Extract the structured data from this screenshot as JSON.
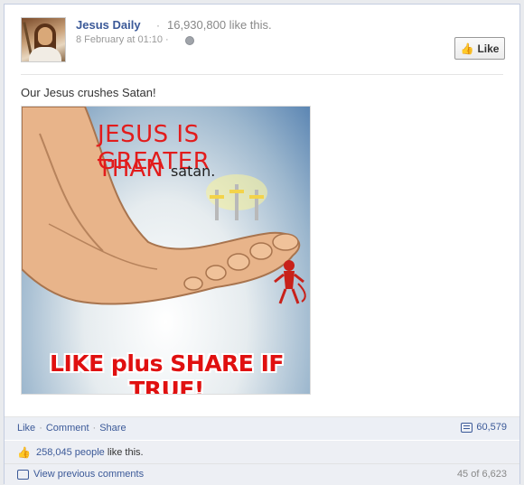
{
  "post": {
    "page_name": "Jesus Daily",
    "separator": "·",
    "page_likes": "16,930,800 like this.",
    "timestamp": "8 February at 01:10 ·",
    "like_button_label": "Like",
    "status_text": "Our Jesus crushes Satan!",
    "image": {
      "headline_line1": "JESUS IS GREATER",
      "headline_line2_big": "THAN",
      "headline_line2_small": "satan.",
      "call_to_action": "LIKE plus SHARE IF TRUE!"
    }
  },
  "actions": {
    "like": "Like",
    "comment": "Comment",
    "share": "Share",
    "dot": "·",
    "comments_count": "60,579"
  },
  "likes": {
    "count_link": "258,045 people",
    "suffix": "like this."
  },
  "comments": {
    "view_previous": "View previous comments",
    "pager": "45 of 6,623"
  },
  "icons": {
    "globe": "globe-icon",
    "thumb": "thumbs-up-icon",
    "comment": "comment-icon",
    "speech": "speech-bubble-icon"
  }
}
